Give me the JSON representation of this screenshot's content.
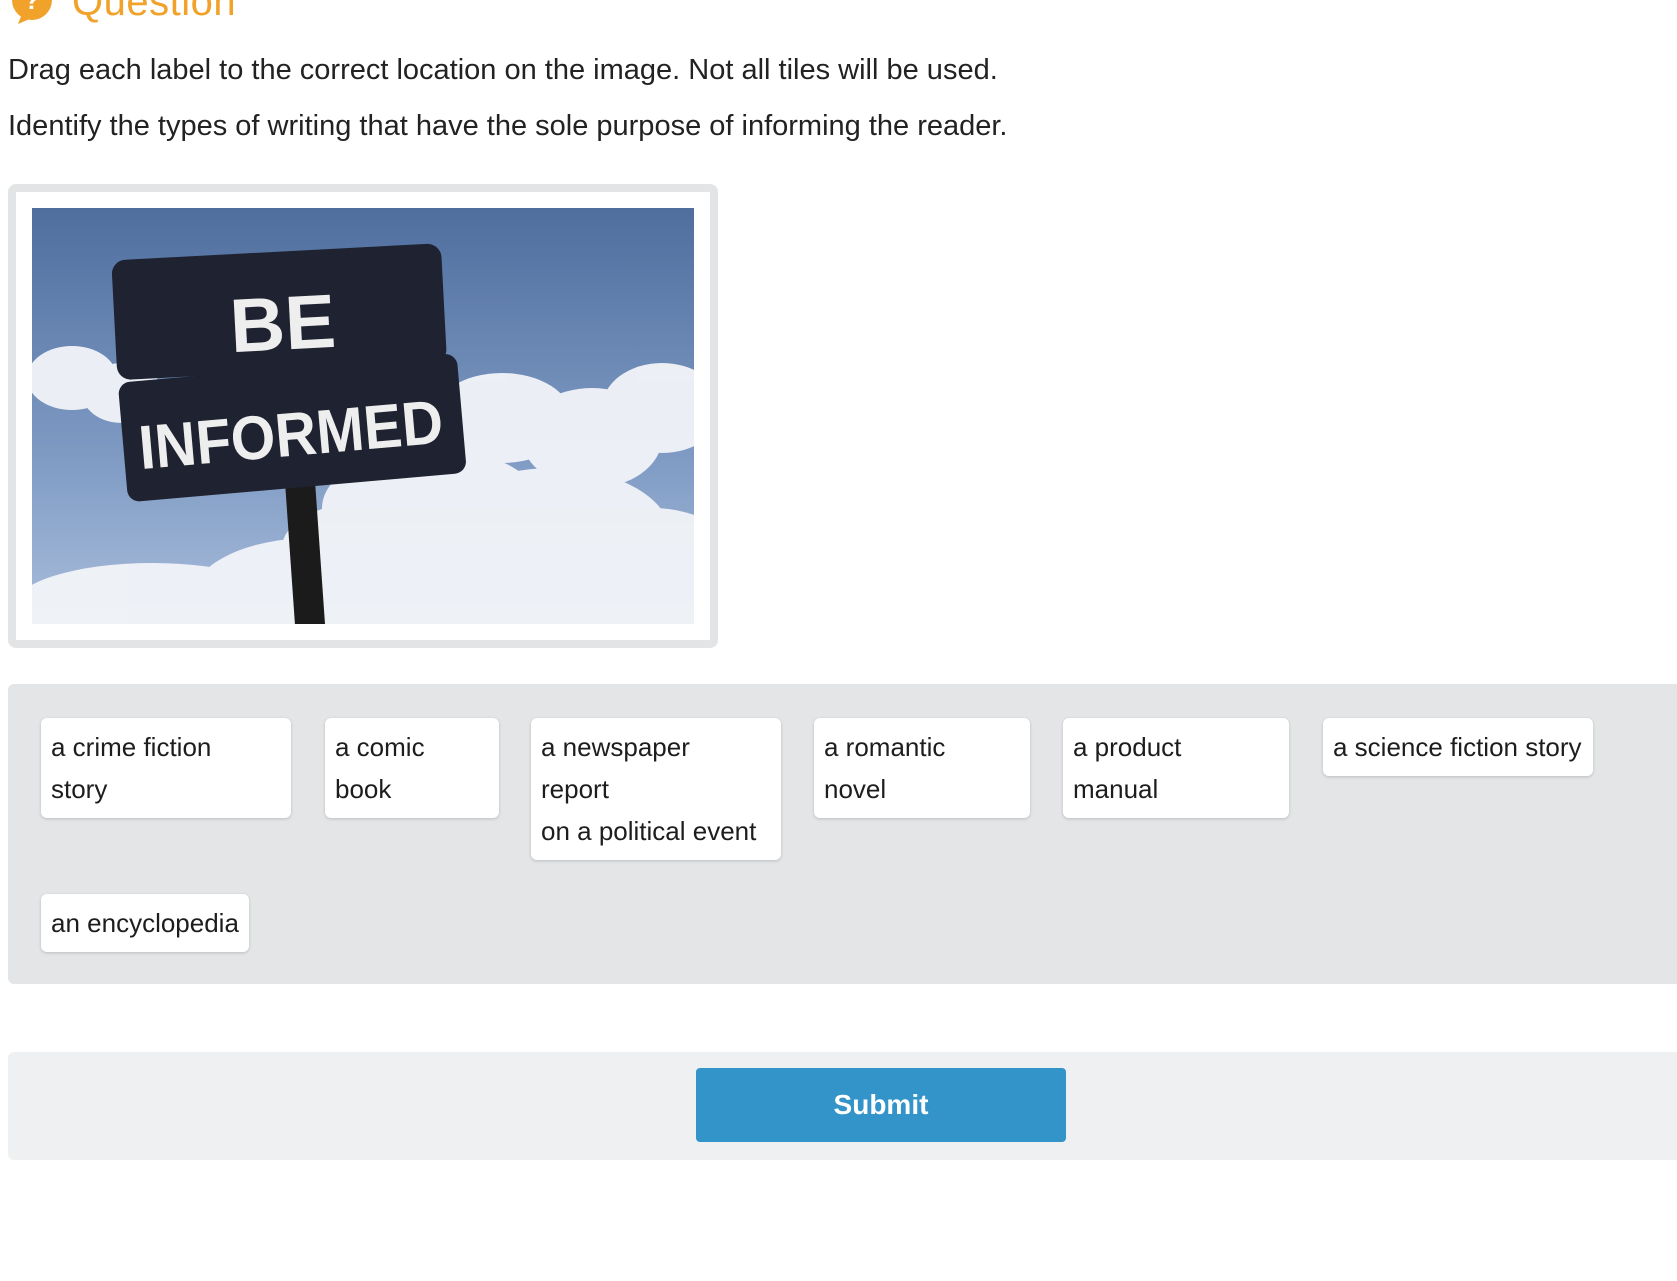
{
  "header": {
    "title": "Question",
    "icon": "question-bubble-icon",
    "accent_color": "#f0a22a"
  },
  "instructions": {
    "line1": "Drag each label to the correct location on the image. Not all tiles will be used.",
    "line2": "Identify the types of writing that have the sole purpose of informing the reader."
  },
  "image": {
    "sign_top": "BE",
    "sign_bottom": "INFORMED"
  },
  "tiles": [
    {
      "label": "a crime fiction\nstory"
    },
    {
      "label": "a comic\nbook"
    },
    {
      "label": "a newspaper\nreport\non a political event"
    },
    {
      "label": "a romantic\nnovel"
    },
    {
      "label": "a product\nmanual"
    },
    {
      "label": "a science fiction story"
    },
    {
      "label": "an encyclopedia"
    }
  ],
  "submit": {
    "label": "Submit",
    "color": "#3294c8"
  }
}
